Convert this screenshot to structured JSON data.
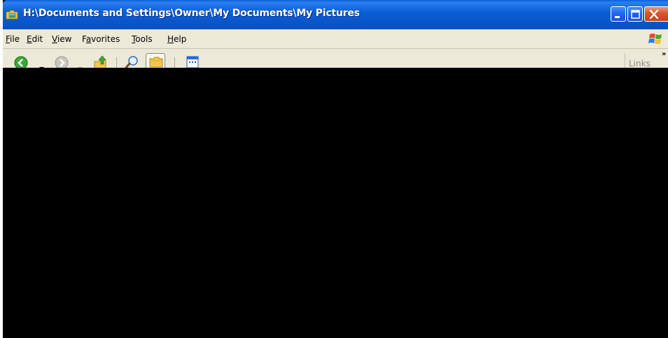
{
  "window": {
    "title": "H:\\Documents and Settings\\Owner\\My Documents\\My Pictures"
  },
  "menu": {
    "items": [
      {
        "label": "File",
        "accel": "F",
        "rest": "ile"
      },
      {
        "label": "Edit",
        "accel": "E",
        "rest": "dit"
      },
      {
        "label": "View",
        "accel": "V",
        "rest": "iew"
      },
      {
        "label": "Favorites",
        "pre": "F",
        "accel": "a",
        "rest": "vorites"
      },
      {
        "label": "Tools",
        "accel": "T",
        "rest": "ools"
      },
      {
        "label": "Help",
        "accel": "H",
        "rest": "elp"
      }
    ]
  },
  "toolbar": {
    "links_label": "Links",
    "chevron": "»"
  },
  "colors": {
    "titlebar": "#0b56cc",
    "menubar": "#ede9d8",
    "close": "#d8552a",
    "content": "#000000"
  },
  "icons": {
    "title": "folder-pictures-icon",
    "back": "back-arrow-icon",
    "forward": "forward-arrow-icon",
    "up": "up-folder-icon",
    "search": "search-icon",
    "folders": "folders-icon",
    "views": "views-icon",
    "logo": "windows-flag-icon"
  }
}
